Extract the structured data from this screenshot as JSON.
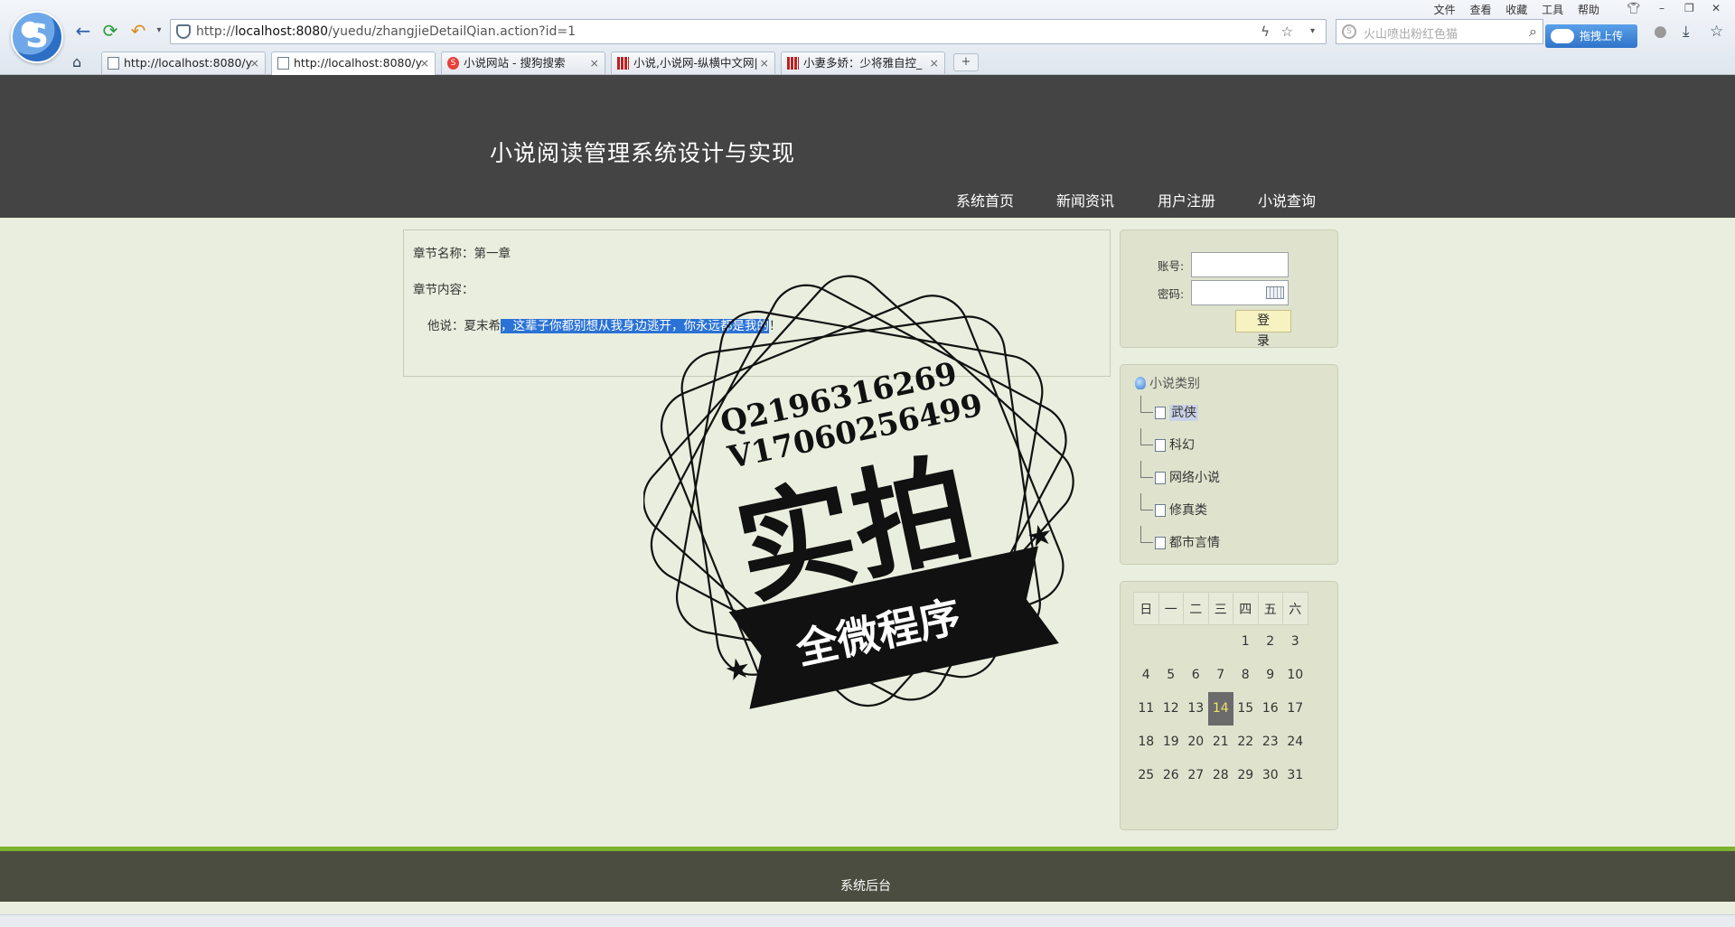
{
  "browser": {
    "url_prefix": "http://",
    "url_host": "localhost:8080",
    "url_path": "/yuedu/zhangjieDetailQian.action?id=1",
    "search_placeholder": "火山喷出粉红色猫",
    "upload_label": "拖拽上传",
    "menu": [
      "文件",
      "查看",
      "收藏",
      "工具",
      "帮助"
    ],
    "tabs": [
      {
        "label": "http://localhost:8080/y",
        "icon": "doc-icon"
      },
      {
        "label": "http://localhost:8080/y",
        "icon": "doc-icon",
        "active": true
      },
      {
        "label": "小说网站 - 搜狗搜索",
        "icon": "sogou-icon"
      },
      {
        "label": "小说,小说网-纵横中文网|",
        "icon": "site-icon"
      },
      {
        "label": "小妻多娇：少将雅自控_",
        "icon": "site-icon"
      }
    ]
  },
  "site": {
    "title": "小说阅读管理系统设计与实现",
    "nav": [
      "系统首页",
      "新闻资讯",
      "用户注册",
      "小说查询"
    ]
  },
  "chapter": {
    "name_label": "章节名称：",
    "name_value": "第一章",
    "content_label": "章节内容：",
    "content_lead": "他说：夏末希",
    "content_highlight": "，这辈子你都别想从我身边逃开，你永远都是我的",
    "content_end": "！"
  },
  "login": {
    "account_label": "账号:",
    "password_label": "密码:",
    "button": "登 录"
  },
  "categories": {
    "title": "小说类别",
    "items": [
      "武侠",
      "科幻",
      "网络小说",
      "修真类",
      "都市言情"
    ]
  },
  "calendar": {
    "weekdays": [
      "日",
      "一",
      "二",
      "三",
      "四",
      "五",
      "六"
    ],
    "rows": [
      [
        "",
        "",
        "",
        "",
        "1",
        "2",
        "3"
      ],
      [
        "4",
        "5",
        "6",
        "7",
        "8",
        "9",
        "10"
      ],
      [
        "11",
        "12",
        "13",
        "14",
        "15",
        "16",
        "17"
      ],
      [
        "18",
        "19",
        "20",
        "21",
        "22",
        "23",
        "24"
      ],
      [
        "25",
        "26",
        "27",
        "28",
        "29",
        "30",
        "31"
      ]
    ],
    "today": "14"
  },
  "footer": {
    "link": "系统后台"
  },
  "watermark": {
    "line1": "Q2196316269",
    "line2": "V17060256499",
    "big": "实拍",
    "banner": "全微程序"
  },
  "colors": {
    "header_bg": "#444444",
    "page_bg": "#eaeede",
    "footer_accent": "#7ab32e",
    "footer_bg": "#4b4d40",
    "selection": "#2a72d6"
  }
}
